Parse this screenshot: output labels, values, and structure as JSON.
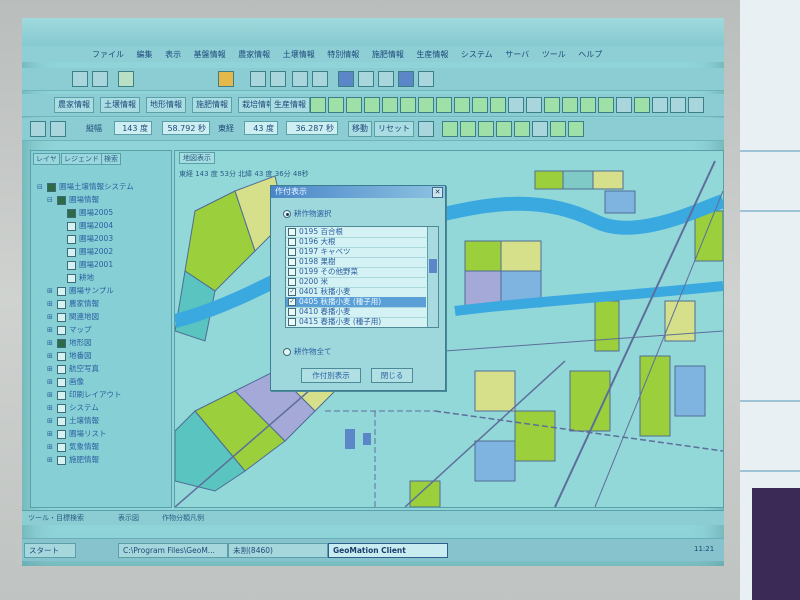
{
  "menu": [
    "ファイル",
    "編集",
    "表示",
    "基盤情報",
    "農家情報",
    "土壌情報",
    "特別情報",
    "施肥情報",
    "生産情報",
    "システム",
    "サーバ",
    "ツール",
    "ヘルプ"
  ],
  "nav_buttons": [
    "農家情報",
    "土壌情報",
    "地形情報",
    "施肥情報",
    "栽培情報",
    "生産情報"
  ],
  "controls": {
    "sort_label": "縦幅",
    "val1": "143 度",
    "val2": "58.792 秒",
    "east_label": "東経",
    "val3": "43 度",
    "val4": "36.287 秒",
    "move_btn": "移動",
    "reset_btn": "リセット"
  },
  "left_panel": {
    "tabs": [
      "レイヤ",
      "レジェンド",
      "検索"
    ],
    "tree": [
      {
        "label": "圃場土壌情報システム",
        "indent": 0,
        "checked": true,
        "expander": "⊟"
      },
      {
        "label": "圃場情報",
        "indent": 1,
        "checked": true,
        "expander": "⊟"
      },
      {
        "label": "圃場2005",
        "indent": 2,
        "checked": true,
        "expander": ""
      },
      {
        "label": "圃場2004",
        "indent": 2,
        "checked": false,
        "expander": ""
      },
      {
        "label": "圃場2003",
        "indent": 2,
        "checked": false,
        "expander": ""
      },
      {
        "label": "圃場2002",
        "indent": 2,
        "checked": false,
        "expander": ""
      },
      {
        "label": "圃場2001",
        "indent": 2,
        "checked": false,
        "expander": ""
      },
      {
        "label": "耕地",
        "indent": 2,
        "checked": false,
        "expander": ""
      },
      {
        "label": "圃場サンプル",
        "indent": 1,
        "checked": false,
        "expander": "⊞"
      },
      {
        "label": "農家情報",
        "indent": 1,
        "checked": false,
        "expander": "⊞"
      },
      {
        "label": "関連地図",
        "indent": 1,
        "checked": false,
        "expander": "⊞"
      },
      {
        "label": "マップ",
        "indent": 1,
        "checked": false,
        "expander": "⊞"
      },
      {
        "label": "地形図",
        "indent": 1,
        "checked": true,
        "expander": "⊞"
      },
      {
        "label": "地番図",
        "indent": 1,
        "checked": false,
        "expander": "⊞"
      },
      {
        "label": "航空写真",
        "indent": 1,
        "checked": false,
        "expander": "⊞"
      },
      {
        "label": "画像",
        "indent": 1,
        "checked": false,
        "expander": "⊞"
      },
      {
        "label": "印刷レイアウト",
        "indent": 1,
        "checked": false,
        "expander": "⊞"
      },
      {
        "label": "システム",
        "indent": 1,
        "checked": false,
        "expander": "⊞"
      },
      {
        "label": "土壌情報",
        "indent": 1,
        "checked": false,
        "expander": "⊞"
      },
      {
        "label": "圃場リスト",
        "indent": 1,
        "checked": false,
        "expander": "⊞"
      },
      {
        "label": "気象情報",
        "indent": 1,
        "checked": false,
        "expander": "⊞"
      },
      {
        "label": "施肥情報",
        "indent": 1,
        "checked": false,
        "expander": "⊞"
      }
    ]
  },
  "map": {
    "tab": "地図表示",
    "status": "東経 143 度 53分 北緯 43 度 36分 48秒"
  },
  "dialog": {
    "title": "作付表示",
    "radio_select": "耕作物選択",
    "radio_all": "耕作物全て",
    "items": [
      {
        "label": "0195 百合根",
        "checked": false,
        "selected": false
      },
      {
        "label": "0196 大根",
        "checked": false,
        "selected": false
      },
      {
        "label": "0197 キャベツ",
        "checked": false,
        "selected": false
      },
      {
        "label": "0198 果樹",
        "checked": false,
        "selected": false
      },
      {
        "label": "0199 その他野菜",
        "checked": false,
        "selected": false
      },
      {
        "label": "0200 米",
        "checked": false,
        "selected": false
      },
      {
        "label": "0401 秋播小麦",
        "checked": true,
        "selected": false
      },
      {
        "label": "0405 秋播小麦 (種子用)",
        "checked": true,
        "selected": true
      },
      {
        "label": "0410 春播小麦",
        "checked": false,
        "selected": false
      },
      {
        "label": "0415 春播小麦 (種子用)",
        "checked": false,
        "selected": false
      }
    ],
    "btn_show": "作付別表示",
    "btn_close": "閉じる"
  },
  "bottom_tabs": [
    "ツール・目標検索",
    "表示図",
    "作物分類凡例"
  ],
  "taskbar": {
    "start": "スタート",
    "tasks": [
      "C:\\Program Files\\GeoM...",
      "未割(8460)",
      "GeoMation Client"
    ],
    "clock": "11:21"
  },
  "colors": {
    "river": "#3aa9e0",
    "field_green": "#9ccf3c",
    "field_yellow": "#d6e08a",
    "field_teal": "#59c4c0",
    "field_blue": "#7fb3e0",
    "field_purple": "#a5a9d8",
    "road": "#5d6e9a"
  }
}
